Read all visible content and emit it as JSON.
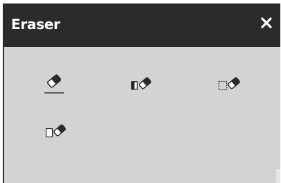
{
  "panel": {
    "title": "Eraser",
    "close_glyph": "✕",
    "close_icon": "close-icon",
    "colors": {
      "titlebar": "#2b2b2b",
      "body": "#d3d3d3",
      "icon": "#2a2a2a",
      "selected_underline": "#5a5a5a"
    }
  },
  "tools": [
    {
      "id": "stroke-eraser",
      "icon": "eraser-icon",
      "selected": true
    },
    {
      "id": "half-area-eraser",
      "icon": "eraser-half-icon",
      "selected": false
    },
    {
      "id": "marquee-eraser",
      "icon": "eraser-marquee-icon",
      "selected": false
    },
    {
      "id": "box-eraser",
      "icon": "eraser-box-icon",
      "selected": false
    }
  ]
}
